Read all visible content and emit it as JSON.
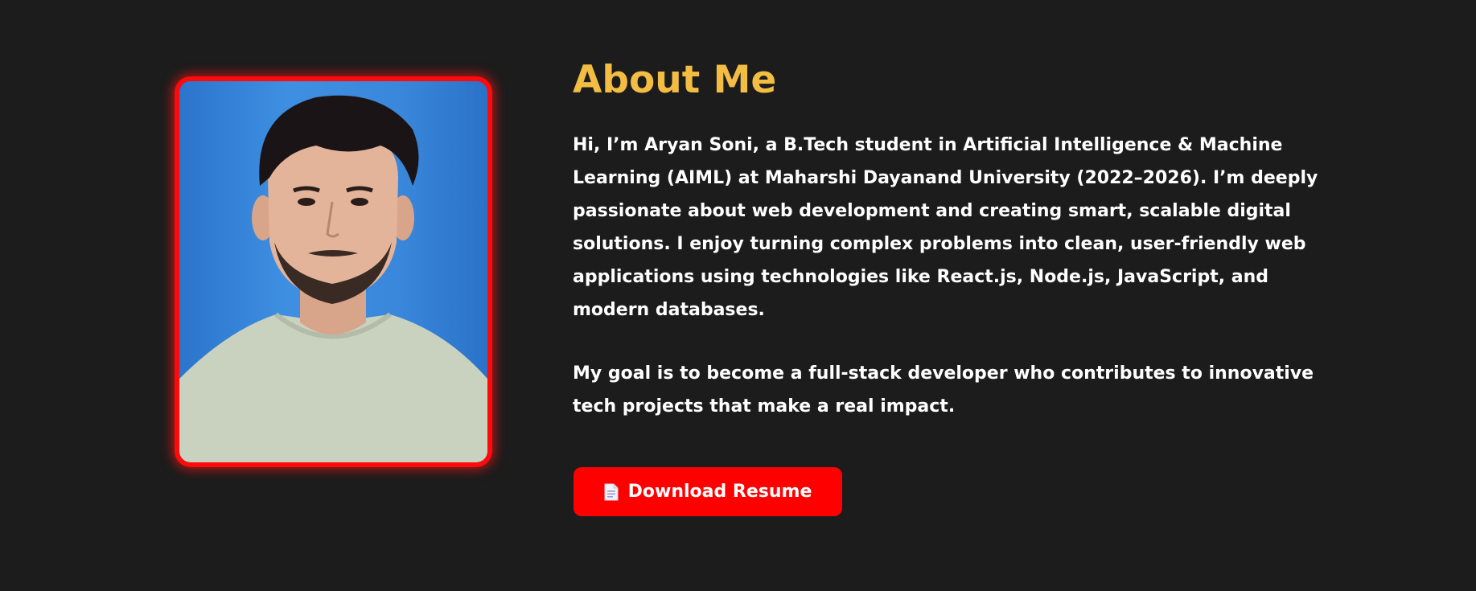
{
  "about": {
    "heading": "About Me",
    "paragraph_1": "Hi, I’m Aryan Soni, a B.Tech student in Artificial Intelligence & Machine Learning (AIML) at Maharshi Dayanand University (2022–2026). I’m deeply passionate about web development and creating smart, scalable digital solutions. I enjoy turning complex problems into clean, user-friendly web applications using technologies like React.js, Node.js, JavaScript, and modern databases.",
    "paragraph_2": "My goal is to become a full-stack developer who contributes to innovative tech projects that make a real impact.",
    "button_label": "Download Resume",
    "button_icon": "document-icon"
  },
  "colors": {
    "background": "#1c1c1c",
    "heading": "#f2bd42",
    "text": "#ffffff",
    "accent_red": "#ff0000"
  }
}
